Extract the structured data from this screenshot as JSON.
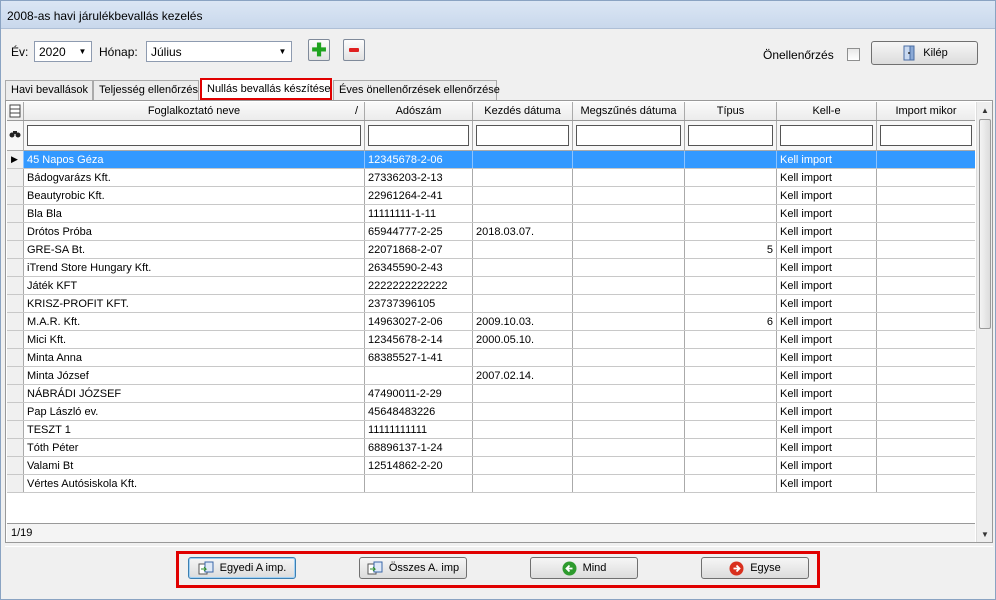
{
  "window": {
    "title": "2008-as havi járulékbevallás kezelés"
  },
  "toolbar": {
    "year_label": "Év:",
    "year_value": "2020",
    "month_label": "Hónap:",
    "month_value": "Július",
    "add_icon": "plus-icon",
    "remove_icon": "minus-icon",
    "self_check_label": "Önellenőrzés",
    "self_check_checked": false,
    "exit_label": "Kilép"
  },
  "tabs": [
    {
      "label": "Havi bevallások",
      "active": false
    },
    {
      "label": "Teljesség ellenőrzés",
      "active": false
    },
    {
      "label": "Nullás bevallás készítése",
      "active": true
    },
    {
      "label": "Éves önellenőrzések ellenőrzése",
      "active": false
    }
  ],
  "grid": {
    "columns": [
      "Foglalkoztató neve",
      "Adószám",
      "Kezdés dátuma",
      "Megszűnés dátuma",
      "Típus",
      "Kell-e",
      "Import mikor"
    ],
    "sort_indicator": "/",
    "rows": [
      [
        "45 Napos Géza",
        "12345678-2-06",
        "",
        "",
        "",
        "Kell import",
        ""
      ],
      [
        "Bádogvarázs Kft.",
        "27336203-2-13",
        "",
        "",
        "",
        "Kell import",
        ""
      ],
      [
        "Beautyrobic Kft.",
        "22961264-2-41",
        "",
        "",
        "",
        "Kell import",
        ""
      ],
      [
        "Bla Bla",
        "11111111-1-11",
        "",
        "",
        "",
        "Kell import",
        ""
      ],
      [
        "Drótos Próba",
        "65944777-2-25",
        "2018.03.07.",
        "",
        "",
        "Kell import",
        ""
      ],
      [
        "GRE-SA Bt.",
        "22071868-2-07",
        "",
        "",
        "5",
        "Kell import",
        ""
      ],
      [
        "iTrend Store Hungary Kft.",
        "26345590-2-43",
        "",
        "",
        "",
        "Kell import",
        ""
      ],
      [
        "Játék KFT",
        "2222222222222",
        "",
        "",
        "",
        "Kell import",
        ""
      ],
      [
        "KRISZ-PROFIT KFT.",
        "23737396105",
        "",
        "",
        "",
        "Kell import",
        ""
      ],
      [
        "M.A.R. Kft.",
        "14963027-2-06",
        "2009.10.03.",
        "",
        "6",
        "Kell import",
        ""
      ],
      [
        "Mici Kft.",
        "12345678-2-14",
        "2000.05.10.",
        "",
        "",
        "Kell import",
        ""
      ],
      [
        "Minta Anna",
        "68385527-1-41",
        "",
        "",
        "",
        "Kell import",
        ""
      ],
      [
        "Minta József",
        "",
        "2007.02.14.",
        "",
        "",
        "Kell import",
        ""
      ],
      [
        "NÁBRÁDI JÓZSEF",
        "47490011-2-29",
        "",
        "",
        "",
        "Kell import",
        ""
      ],
      [
        "Pap László ev.",
        "45648483226",
        "",
        "",
        "",
        "Kell import",
        ""
      ],
      [
        "TESZT 1",
        "11111111111",
        "",
        "",
        "",
        "Kell import",
        ""
      ],
      [
        "Tóth Péter",
        "68896137-1-24",
        "",
        "",
        "",
        "Kell import",
        ""
      ],
      [
        "Valami Bt",
        "12514862-2-20",
        "",
        "",
        "",
        "Kell import",
        ""
      ],
      [
        "Vértes Autósiskola Kft.",
        "",
        "",
        "",
        "",
        "Kell import",
        ""
      ]
    ],
    "selected_row": 0,
    "record_position": "1/19"
  },
  "actions": {
    "single_import": "Egyedi A imp.",
    "all_import": "Összes A. imp",
    "all": "Mind",
    "none": "Egyse"
  },
  "colors": {
    "selection": "#3399ff",
    "highlight_frame": "#e00000"
  }
}
